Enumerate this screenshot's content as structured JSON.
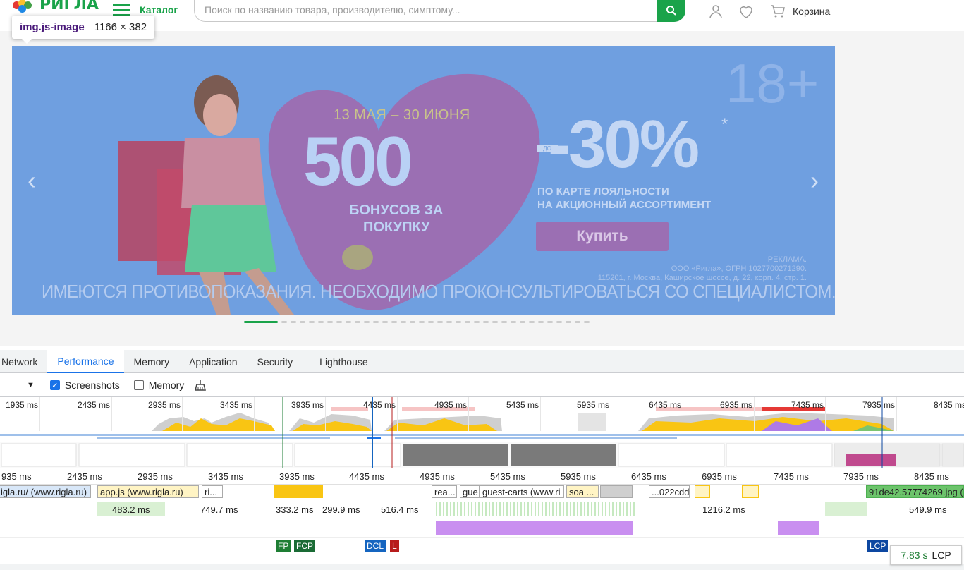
{
  "site": {
    "logo_text": "РИГЛА",
    "catalog_label": "Каталог",
    "search_placeholder": "Поиск по названию товара, производителю, симптому...",
    "cart_label": "Корзина"
  },
  "inspect_tooltip": {
    "selector": "img.js-image",
    "size": "1166 × 382"
  },
  "banner": {
    "dates": "13 МАЯ – 30 ИЮНЯ",
    "big_number": "500",
    "bonus_line1": "БОНУСОВ ЗА",
    "bonus_line2": "ПОКУПКУ",
    "upto": "ДО",
    "discount": "-30%",
    "asterisk": "*",
    "age": "18+",
    "loyalty_line1": "ПО КАРТЕ ЛОЯЛЬНОСТИ",
    "loyalty_line2": "НА АКЦИОННЫЙ АССОРТИМЕНТ",
    "buy_button": "Купить",
    "ad_line1": "РЕКЛАМА.",
    "ad_line2": "ООО «Ригла», ОГРН 1027700271290.",
    "ad_line3": "115201, г. Москва, Каширское шоссе, д. 22, корп. 4, стр. 1.",
    "disclaimer": "ИМЕЮТСЯ ПРОТИВОПОКАЗАНИЯ. НЕОБХОДИМО ПРОКОНСУЛЬТИРОВАТЬСЯ СО СПЕЦИАЛИСТОМ.",
    "prev_arrow": "‹",
    "next_arrow": "›"
  },
  "devtools": {
    "tabs": [
      {
        "label": "Network",
        "active": false
      },
      {
        "label": "Performance",
        "active": true
      },
      {
        "label": "Memory",
        "active": false
      },
      {
        "label": "Application",
        "active": false
      },
      {
        "label": "Security",
        "active": false
      },
      {
        "label": "Lighthouse",
        "active": false
      }
    ],
    "toolbar": {
      "screenshots_label": "Screenshots",
      "screenshots_checked": true,
      "memory_label": "Memory",
      "memory_checked": false
    },
    "overview_ticks": [
      "1935 ms",
      "2435 ms",
      "2935 ms",
      "3435 ms",
      "3935 ms",
      "4435 ms",
      "4935 ms",
      "5435 ms",
      "5935 ms",
      "6435 ms",
      "6935 ms",
      "7435 ms",
      "7935 ms",
      "8435 ms"
    ],
    "timeline_ticks": [
      "935 ms",
      "2435 ms",
      "2935 ms",
      "3435 ms",
      "3935 ms",
      "4435 ms",
      "4935 ms",
      "5435 ms",
      "5935 ms",
      "6435 ms",
      "6935 ms",
      "7435 ms",
      "7935 ms",
      "8435 ms"
    ],
    "network_bars": [
      {
        "label": "igla.ru/ (www.rigla.ru)"
      },
      {
        "label": "app.js (www.rigla.ru)"
      },
      {
        "label": "ri..."
      },
      {
        "label": "rea..."
      },
      {
        "label": "gue"
      },
      {
        "label": "guest-carts (www.ri"
      },
      {
        "label": "soa ..."
      },
      {
        "label": "...022cdd"
      },
      {
        "label": "91de42.57774269.jpg (..."
      }
    ],
    "durations": [
      "483.2 ms",
      "749.7 ms",
      "333.2 ms",
      "299.9 ms",
      "516.4 ms",
      "1216.2 ms",
      "549.9 ms"
    ],
    "markers": [
      {
        "label": "FP",
        "color": "#1e7e34"
      },
      {
        "label": "FCP",
        "color": "#1a6b35"
      },
      {
        "label": "DCL",
        "color": "#1565c0"
      },
      {
        "label": "L",
        "color": "#b71c1c"
      },
      {
        "label": "LCP",
        "color": "#0d47a1"
      }
    ],
    "lcp_tooltip": {
      "time": "7.83 s",
      "label": "LCP"
    },
    "colors": {
      "accent": "#1a73e8",
      "scripting": "#f9c513",
      "rendering": "#ae7ae6",
      "painting": "#7bc46f",
      "idle": "#cfcfcf"
    }
  }
}
